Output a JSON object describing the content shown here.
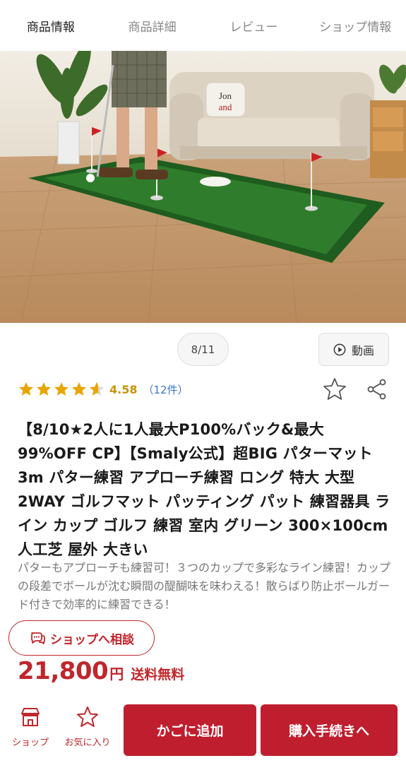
{
  "tabs": [
    {
      "label": "商品情報",
      "active": true
    },
    {
      "label": "商品詳細",
      "active": false
    },
    {
      "label": "レビュー",
      "active": false
    },
    {
      "label": "ショップ情報",
      "active": false
    }
  ],
  "hero": {
    "pillow_text": "Jon and",
    "pager": "8/11",
    "video_label": "動画"
  },
  "rating": {
    "value": "4.58",
    "count": "（12件）",
    "stars": 4.58,
    "star_color": "#e8a500"
  },
  "product": {
    "title": "【8/10★2人に1人最大P100%バック&最大99%OFF CP】【Smaly公式】超BIG パターマット 3m パター練習 アプローチ練習 ロング 特大 大型 2WAY ゴルフマット パッティング パット 練習器具 ライン カップ ゴルフ 練習 室内 グリーン 300×100cm 人工芝 屋外 大きい",
    "description": "パターもアプローチも練習可！３つのカップで多彩なライン練習！カップの段差でボールが沈む瞬間の醍醐味を味わえる！散らばり防止ボールガード付きで効率的に練習できる！"
  },
  "consult": {
    "label": "ショップへ相談"
  },
  "price": {
    "amount": "21,800",
    "currency": "円",
    "shipping": "送料無料"
  },
  "bottom_bar": {
    "shop_label": "ショップ",
    "fav_label": "お気に入り",
    "cart_label": "かごに追加",
    "buy_label": "購入手続きへ"
  },
  "colors": {
    "accent": "#bf1e2e",
    "link": "#3a78c9",
    "rating": "#c99400"
  }
}
